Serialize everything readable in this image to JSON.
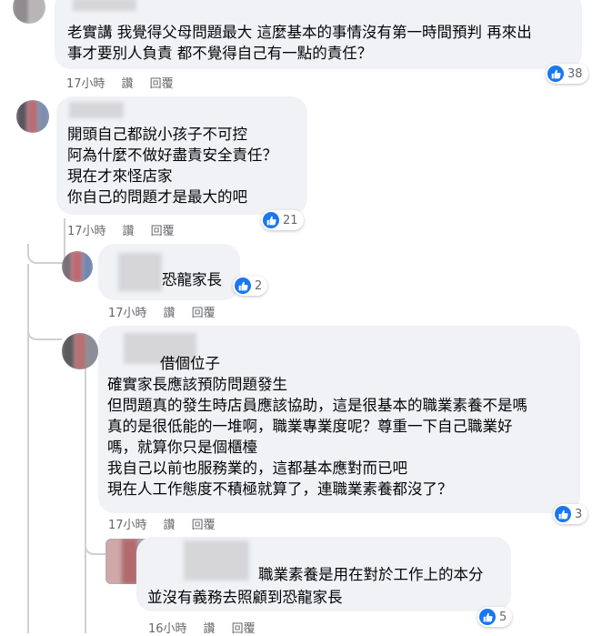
{
  "comments": [
    {
      "lines": [
        "老實講 我覺得父母問題最大 這麼基本的事情沒有第一時間預判 再來出",
        "事才要別人負責 都不覺得自己有一點的責任？"
      ],
      "time": "17小時",
      "like": "讚",
      "reply": "回覆",
      "reactions": "38"
    },
    {
      "lines": [
        "開頭自己都說小孩子不可控",
        "阿為什麼不做好盡責安全責任？",
        "現在才來怪店家",
        "你自己的問題才是最大的吧"
      ],
      "time": "17小時",
      "like": "讚",
      "reply": "回覆",
      "reactions": "21"
    },
    {
      "lines": [
        "恐龍家長"
      ],
      "time": "17小時",
      "like": "讚",
      "reply": "回覆",
      "reactions": "2"
    },
    {
      "lines": [
        "借個位子",
        "確實家長應該預防問題發生",
        "但問題真的發生時店員應該協助，這是很基本的職業素養不是嗎",
        "真的是很低能的一堆啊，職業專業度呢？尊重一下自己職業好",
        "嗎，就算你只是個櫃檯",
        "我自己以前也服務業的，這都基本應對而已吧",
        "現在人工作態度不積極就算了，連職業素養都沒了？"
      ],
      "time": "17小時",
      "like": "讚",
      "reply": "回覆",
      "reactions": "3"
    },
    {
      "lines": [
        "職業素養是用在對於工作上的本分",
        "並沒有義務去照顧到恐龍家長"
      ],
      "time": "16小時",
      "like": "讚",
      "reply": "回覆",
      "reactions": "5"
    }
  ],
  "colors": {
    "bubble": "#f0f2f5",
    "like_blue": "#1877f2",
    "meta": "#65676b"
  },
  "icons": {
    "reaction": "like-thumb-icon"
  }
}
